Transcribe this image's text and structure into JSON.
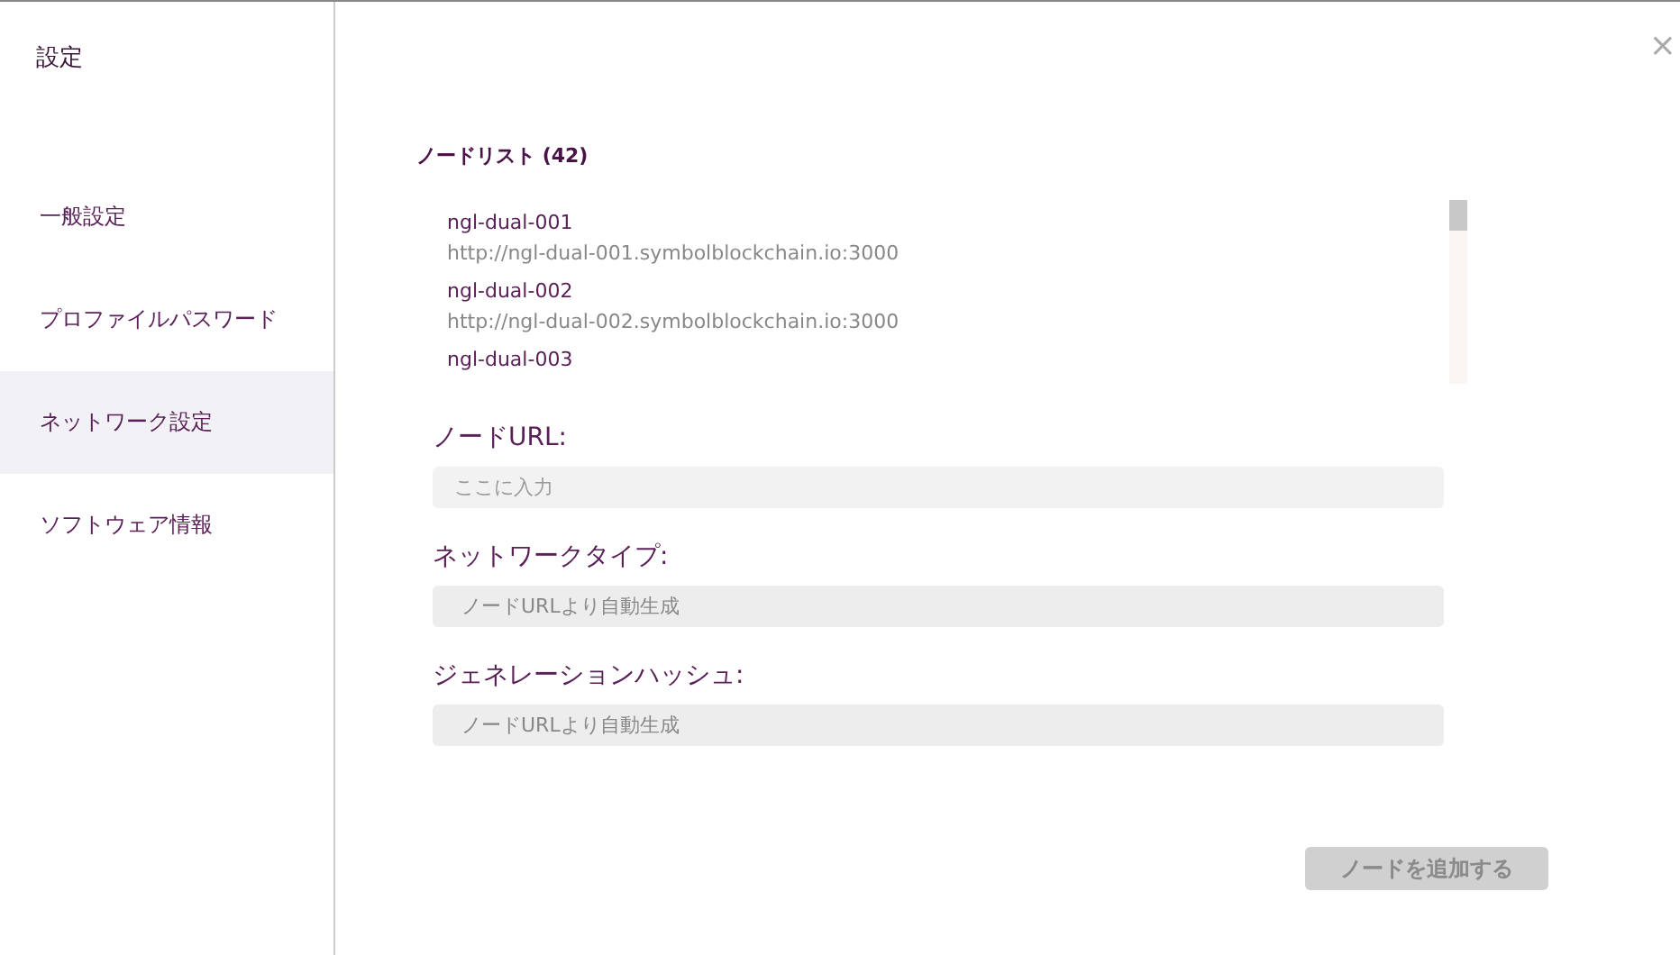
{
  "sidebar": {
    "title": "設定",
    "items": [
      {
        "label": "一般設定",
        "selected": false
      },
      {
        "label": "プロファイルパスワード",
        "selected": false
      },
      {
        "label": "ネットワーク設定",
        "selected": true
      },
      {
        "label": "ソフトウェア情報",
        "selected": false
      }
    ]
  },
  "close": "×",
  "node_list": {
    "title": "ノードリスト (42)",
    "nodes": [
      {
        "name": "ngl-dual-001",
        "url": "http://ngl-dual-001.symbolblockchain.io:3000"
      },
      {
        "name": "ngl-dual-002",
        "url": "http://ngl-dual-002.symbolblockchain.io:3000"
      },
      {
        "name": "ngl-dual-003"
      }
    ]
  },
  "fields": [
    {
      "label": "ノードURL:",
      "placeholder": "ここに入力",
      "disabled": false
    },
    {
      "label": "ネットワークタイプ:",
      "value": "ノードURLより自動生成",
      "disabled": true
    },
    {
      "label": "ジェネレーションハッシュ:",
      "value": "ノードURLより自動生成",
      "disabled": true
    }
  ],
  "add_button": {
    "label": "ノードを追加する",
    "disabled": true
  }
}
